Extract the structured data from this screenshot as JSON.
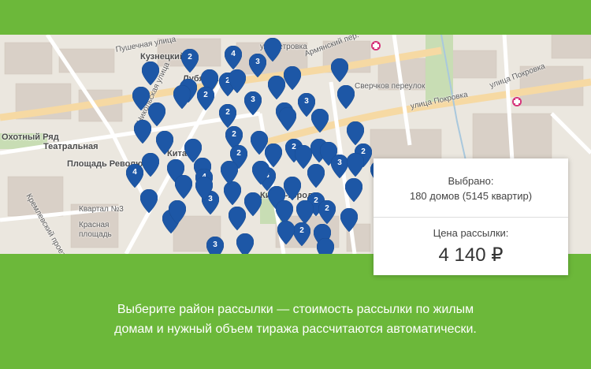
{
  "map": {
    "labels": [
      {
        "name": "label-kuznetsky",
        "text": "Кузнецкий",
        "cls": "big"
      },
      {
        "name": "label-lubyanka",
        "text": "Лубянка",
        "cls": "big"
      },
      {
        "name": "label-okhotny",
        "text": "Охотный Ряд",
        "cls": "big"
      },
      {
        "name": "label-teatralnaya",
        "text": "Театральная",
        "cls": "big"
      },
      {
        "name": "label-revolution",
        "text": "Площадь Революции",
        "cls": "big"
      },
      {
        "name": "label-kitay",
        "text": "Китай-",
        "cls": "big"
      },
      {
        "name": "label-kitay-gorod",
        "text": "Китай-город",
        "cls": "big"
      },
      {
        "name": "label-kvartal",
        "text": "Квартал №3",
        "cls": ""
      },
      {
        "name": "label-krasnaya",
        "text": "Красная",
        "cls": ""
      },
      {
        "name": "label-ploshchad",
        "text": "площадь",
        "cls": ""
      },
      {
        "name": "label-pushechnaya",
        "text": "Пушечная улица",
        "cls": ""
      },
      {
        "name": "label-pokrovka",
        "text": "улица Покровка",
        "cls": ""
      },
      {
        "name": "label-pokrovka2",
        "text": "улица Покровка",
        "cls": ""
      },
      {
        "name": "label-armyansky",
        "text": "Армянский пер.",
        "cls": ""
      },
      {
        "name": "label-sverchkov",
        "text": "Сверчков переулок",
        "cls": ""
      },
      {
        "name": "label-nikolskaya",
        "text": "Никольская улица",
        "cls": ""
      },
      {
        "name": "label-kremlevsky",
        "text": "Кремлевский проезд",
        "cls": ""
      },
      {
        "name": "label-petrovka",
        "text": "ул. Петровка",
        "cls": ""
      }
    ],
    "pins": [
      "",
      "2",
      "4",
      "",
      "3",
      "",
      "",
      "",
      "2",
      "2",
      "",
      "",
      "",
      "",
      "",
      "3",
      "",
      "3",
      "",
      "2",
      "",
      "",
      "",
      "",
      "2",
      "",
      "",
      "",
      "2",
      "",
      "",
      "2",
      "",
      "",
      "",
      "",
      "4",
      "",
      "",
      "2",
      "3",
      "4",
      "",
      "3",
      "",
      "",
      "",
      "2",
      "",
      "3",
      "",
      "",
      "2",
      "",
      "",
      "3",
      "2",
      "",
      "",
      "",
      "",
      "",
      "",
      "",
      "",
      "",
      "",
      "",
      "",
      "",
      ""
    ]
  },
  "panel": {
    "selected_label": "Выбрано:",
    "selected_value": "180 домов (5145 квартир)",
    "price_label": "Цена рассылки:",
    "price_value": "4 140 ₽"
  },
  "caption": {
    "line1": "Выберите район рассылки — стоимость рассылки по жилым",
    "line2": "домам и нужный объем тиража рассчитаются автоматически."
  },
  "colors": {
    "background": "#6cb83a",
    "pin": "#1d57a6",
    "map": "#ece8e0"
  }
}
